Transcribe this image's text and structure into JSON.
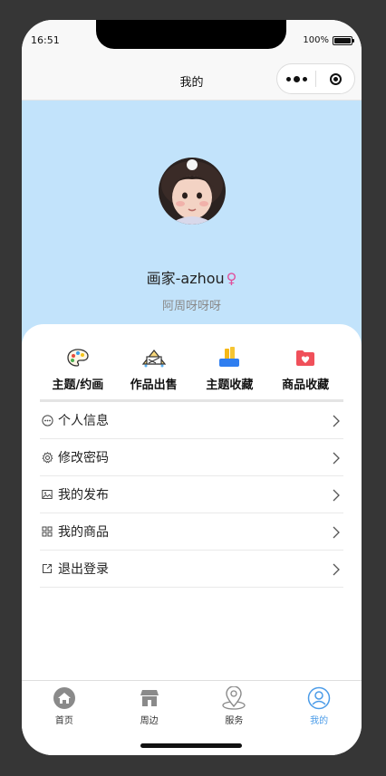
{
  "status_bar": {
    "time": "16:51",
    "battery": "100%"
  },
  "nav": {
    "title": "我的"
  },
  "profile": {
    "name": "画家-azhou",
    "gender_symbol": "♀",
    "subtitle": "阿周呀呀呀"
  },
  "shortcuts": [
    {
      "label": "主题/约画",
      "icon": "palette-icon"
    },
    {
      "label": "作品出售",
      "icon": "artwork-sale-icon"
    },
    {
      "label": "主题收藏",
      "icon": "collection-box-icon"
    },
    {
      "label": "商品收藏",
      "icon": "heart-folder-icon"
    }
  ],
  "menu": [
    {
      "label": "个人信息",
      "icon": "info-dots-icon"
    },
    {
      "label": "修改密码",
      "icon": "gear-icon"
    },
    {
      "label": "我的发布",
      "icon": "image-icon"
    },
    {
      "label": "我的商品",
      "icon": "grid-icon"
    },
    {
      "label": "退出登录",
      "icon": "external-link-icon"
    }
  ],
  "tabbar": [
    {
      "label": "首页",
      "icon": "home-icon",
      "active": false
    },
    {
      "label": "周边",
      "icon": "store-icon",
      "active": false
    },
    {
      "label": "服务",
      "icon": "location-pin-icon",
      "active": false
    },
    {
      "label": "我的",
      "icon": "user-icon",
      "active": true
    }
  ],
  "colors": {
    "hero_bg": "#c2e3fb",
    "accent": "#4a9be8",
    "gender": "#e0509c"
  }
}
